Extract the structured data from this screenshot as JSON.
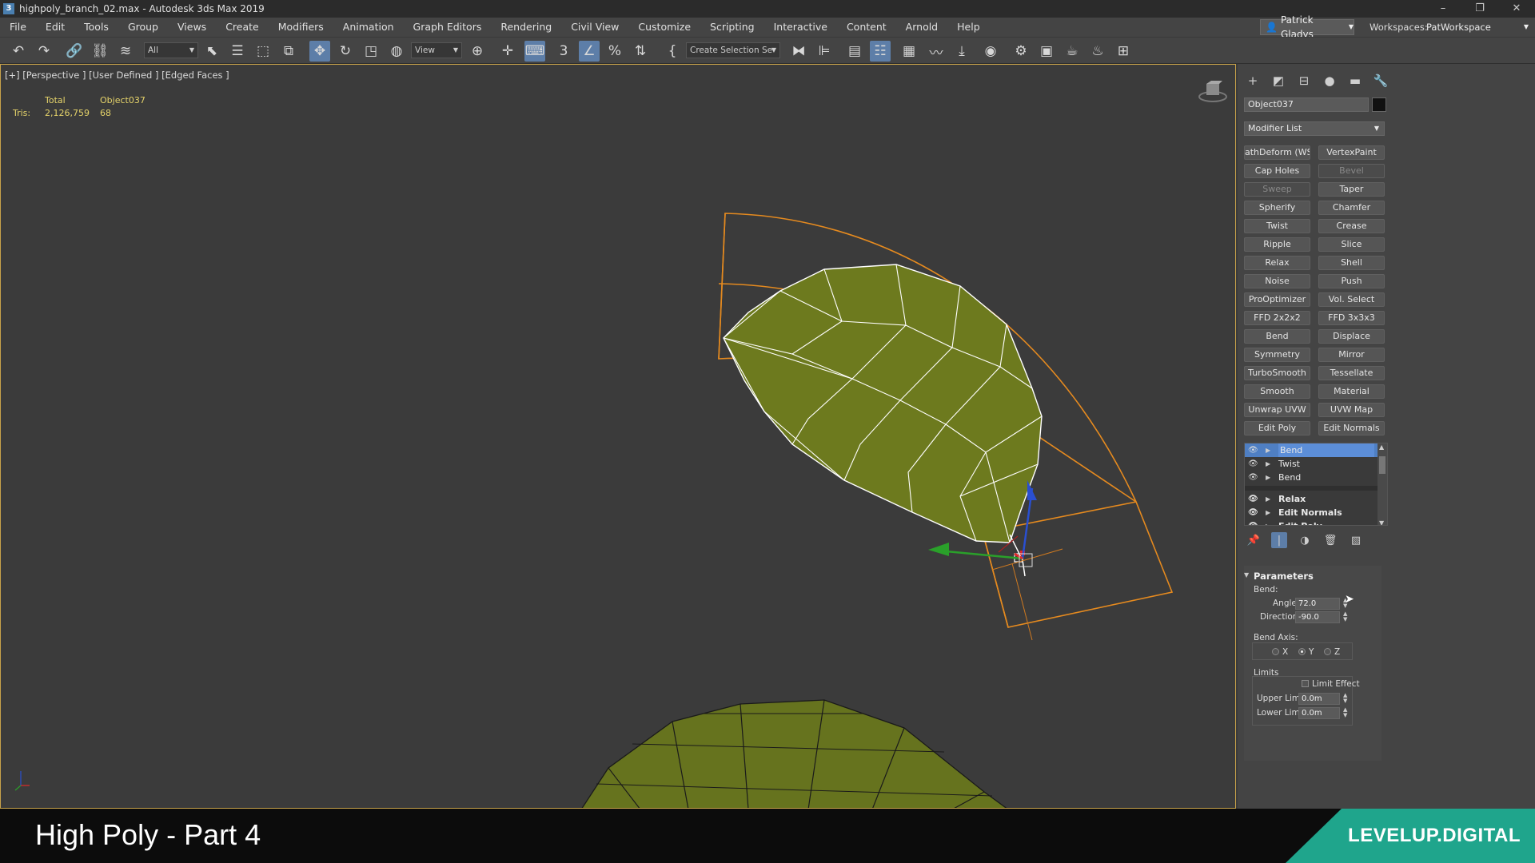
{
  "window": {
    "title": "highpoly_branch_02.max - Autodesk 3ds Max 2019",
    "minimize": "–",
    "restore": "❐",
    "close": "✕"
  },
  "menu": [
    "File",
    "Edit",
    "Tools",
    "Group",
    "Views",
    "Create",
    "Modifiers",
    "Animation",
    "Graph Editors",
    "Rendering",
    "Civil View",
    "Customize",
    "Scripting",
    "Interactive",
    "Content",
    "Arnold",
    "Help"
  ],
  "user": {
    "name": "Patrick Gladys"
  },
  "workspace": {
    "label": "Workspaces:",
    "value": "PatWorkspace"
  },
  "toolbar": {
    "filter": "All",
    "ref_coord": "View",
    "selection_set": "Create Selection Se"
  },
  "viewport": {
    "label": "[+] [Perspective ] [User Defined ] [Edged Faces ]",
    "stats": {
      "total_header": "Total",
      "object_header": "Object037",
      "tris_label": "Tris:",
      "tris_total": "2,126,759",
      "tris_object": "68"
    }
  },
  "command_panel": {
    "object_name": "Object037",
    "modifier_list": "Modifier List",
    "modifier_buttons": [
      {
        "label": "athDeform (WSM",
        "enabled": true
      },
      {
        "label": "VertexPaint",
        "enabled": true
      },
      {
        "label": "Cap Holes",
        "enabled": true
      },
      {
        "label": "Bevel",
        "enabled": false
      },
      {
        "label": "Sweep",
        "enabled": false
      },
      {
        "label": "Taper",
        "enabled": true
      },
      {
        "label": "Spherify",
        "enabled": true
      },
      {
        "label": "Chamfer",
        "enabled": true
      },
      {
        "label": "Twist",
        "enabled": true
      },
      {
        "label": "Crease",
        "enabled": true
      },
      {
        "label": "Ripple",
        "enabled": true
      },
      {
        "label": "Slice",
        "enabled": true
      },
      {
        "label": "Relax",
        "enabled": true
      },
      {
        "label": "Shell",
        "enabled": true
      },
      {
        "label": "Noise",
        "enabled": true
      },
      {
        "label": "Push",
        "enabled": true
      },
      {
        "label": "ProOptimizer",
        "enabled": true
      },
      {
        "label": "Vol. Select",
        "enabled": true
      },
      {
        "label": "FFD 2x2x2",
        "enabled": true
      },
      {
        "label": "FFD 3x3x3",
        "enabled": true
      },
      {
        "label": "Bend",
        "enabled": true
      },
      {
        "label": "Displace",
        "enabled": true
      },
      {
        "label": "Symmetry",
        "enabled": true
      },
      {
        "label": "Mirror",
        "enabled": true
      },
      {
        "label": "TurboSmooth",
        "enabled": true
      },
      {
        "label": "Tessellate",
        "enabled": true
      },
      {
        "label": "Smooth",
        "enabled": true
      },
      {
        "label": "Material",
        "enabled": true
      },
      {
        "label": "Unwrap UVW",
        "enabled": true
      },
      {
        "label": "UVW Map",
        "enabled": true
      },
      {
        "label": "Edit Poly",
        "enabled": true
      },
      {
        "label": "Edit Normals",
        "enabled": true
      }
    ],
    "stack": [
      {
        "label": "Bend",
        "selected": true,
        "bold": false
      },
      {
        "label": "Twist",
        "selected": false,
        "bold": false
      },
      {
        "label": "Bend",
        "selected": false,
        "bold": false
      },
      {
        "label": "Relax",
        "selected": false,
        "bold": true
      },
      {
        "label": "Edit Normals",
        "selected": false,
        "bold": true
      },
      {
        "label": "Edit Poly",
        "selected": false,
        "bold": true
      }
    ],
    "parameters": {
      "title": "Parameters",
      "bend_label": "Bend:",
      "angle_label": "Angle:",
      "angle_value": "72.0",
      "direction_label": "Direction:",
      "direction_value": "-90.0",
      "bend_axis_label": "Bend Axis:",
      "axis_x": "X",
      "axis_y": "Y",
      "axis_z": "Z",
      "selected_axis": "Y",
      "limits_label": "Limits",
      "limit_effect_label": "Limit Effect",
      "upper_limit_label": "Upper Limit:",
      "upper_limit_value": "0.0m",
      "lower_limit_label": "Lower Limit:",
      "lower_limit_value": "0.0m"
    }
  },
  "banner": {
    "title": "High Poly - Part 4",
    "brand": "LEVELUP.DIGITAL"
  },
  "colors": {
    "gizmo": "#e58a1f",
    "leaf": "#6d7a1e",
    "selection_blue": "#4f7fc3",
    "brand_teal": "#1fa58c"
  }
}
